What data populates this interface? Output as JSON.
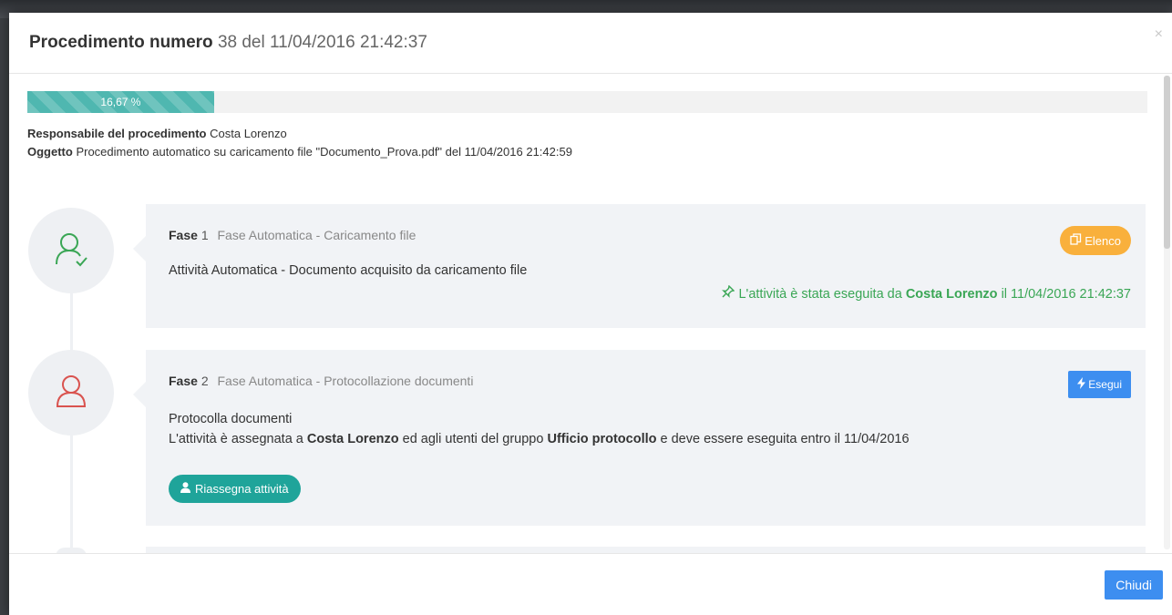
{
  "modal": {
    "title_strong": "Procedimento numero",
    "title_rest": "38 del 11/04/2016 21:42:37",
    "close_glyph": "×"
  },
  "progress": {
    "label": "16,67 %",
    "fraction": 0.1667
  },
  "info": {
    "responsabile_label": "Responsabile del procedimento",
    "responsabile_value": "Costa Lorenzo",
    "oggetto_label": "Oggetto",
    "oggetto_value": "Procedimento automatico su caricamento file \"Documento_Prova.pdf\" del 11/04/2016 21:42:59"
  },
  "phases": [
    {
      "fase_label": "Fase",
      "number": "1",
      "name": "Fase Automatica - Caricamento file",
      "status_color": "#3aa655",
      "icon": "user-check-icon",
      "button_label": "Elenco",
      "button_icon": "copy-icon",
      "description": "Attività Automatica - Documento acquisito da caricamento file",
      "done_prefix": "L'attività è stata eseguita da",
      "done_user": "Costa Lorenzo",
      "done_suffix": "il 11/04/2016 21:42:37",
      "done_icon": "pin-icon"
    },
    {
      "fase_label": "Fase",
      "number": "2",
      "name": "Fase Automatica - Protocollazione documenti",
      "status_color": "#d9534f",
      "icon": "user-icon",
      "button_label": "Esegui",
      "button_icon": "bolt-icon",
      "description": "Protocolla documenti",
      "assign_prefix": "L'attività è assegnata a",
      "assign_user": "Costa Lorenzo",
      "assign_middle": "ed agli utenti del gruppo",
      "assign_group": "Ufficio protocollo",
      "assign_suffix": "e deve essere eseguita entro il 11/04/2016",
      "reassign_label": "Riassegna attività",
      "reassign_icon": "user-solid-icon"
    }
  ],
  "footer": {
    "close_label": "Chiudi"
  },
  "colors": {
    "progress": "#4fb7b0",
    "elenco_button": "#f9b03c",
    "primary_button": "#3d8ef0",
    "reassign_button": "#1fa49a",
    "done_text": "#3aa655",
    "pending_icon": "#d9534f"
  }
}
